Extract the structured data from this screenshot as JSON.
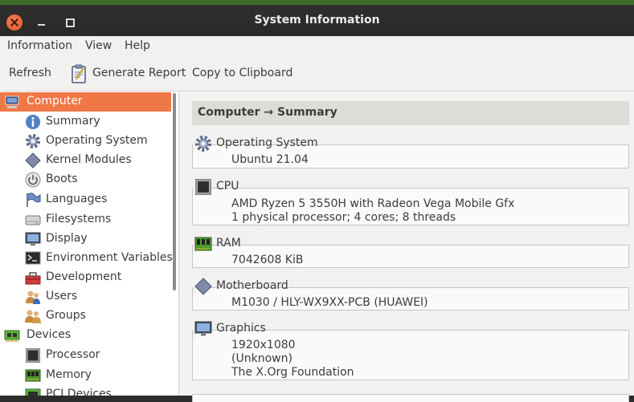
{
  "window": {
    "title": "System Information"
  },
  "menubar": {
    "items": [
      "Information",
      "View",
      "Help"
    ]
  },
  "toolbar": {
    "refresh": "Refresh",
    "generate_report": "Generate Report",
    "copy_clipboard": "Copy to Clipboard"
  },
  "sidebar": {
    "items": [
      {
        "label": "Computer",
        "icon": "computer-icon",
        "selected": true
      },
      {
        "label": "Summary",
        "icon": "info-icon"
      },
      {
        "label": "Operating System",
        "icon": "gear-icon"
      },
      {
        "label": "Kernel Modules",
        "icon": "diamond-icon"
      },
      {
        "label": "Boots",
        "icon": "power-icon"
      },
      {
        "label": "Languages",
        "icon": "flag-icon"
      },
      {
        "label": "Filesystems",
        "icon": "drive-icon"
      },
      {
        "label": "Display",
        "icon": "monitor-icon"
      },
      {
        "label": "Environment Variables",
        "icon": "terminal-icon"
      },
      {
        "label": "Development",
        "icon": "toolbox-icon"
      },
      {
        "label": "Users",
        "icon": "users-icon"
      },
      {
        "label": "Groups",
        "icon": "groups-icon"
      },
      {
        "label": "Devices",
        "icon": "circuit-board-icon"
      },
      {
        "label": "Processor",
        "icon": "chip-icon"
      },
      {
        "label": "Memory",
        "icon": "ram-icon"
      },
      {
        "label": "PCI Devices",
        "icon": "pci-icon"
      }
    ]
  },
  "content": {
    "breadcrumb": "Computer → Summary",
    "sections": [
      {
        "title": "Operating System",
        "icon": "gear-icon",
        "values": [
          "Ubuntu 21.04"
        ]
      },
      {
        "title": "CPU",
        "icon": "chip-icon",
        "values": [
          "AMD Ryzen 5 3550H with Radeon Vega Mobile Gfx",
          "1 physical processor; 4 cores; 8 threads"
        ]
      },
      {
        "title": "RAM",
        "icon": "ram-icon",
        "values": [
          "7042608 KiB"
        ]
      },
      {
        "title": "Motherboard",
        "icon": "diamond-icon",
        "values": [
          "M1030 / HLY-WX9XX-PCB (HUAWEI)"
        ]
      },
      {
        "title": "Graphics",
        "icon": "monitor-icon",
        "values": [
          "1920x1080",
          "(Unknown)",
          "The X.Org Foundation"
        ]
      }
    ]
  },
  "colors": {
    "selection": "#f07746",
    "close_button": "#e35b2b",
    "titlebar": "#2c2c2a"
  }
}
